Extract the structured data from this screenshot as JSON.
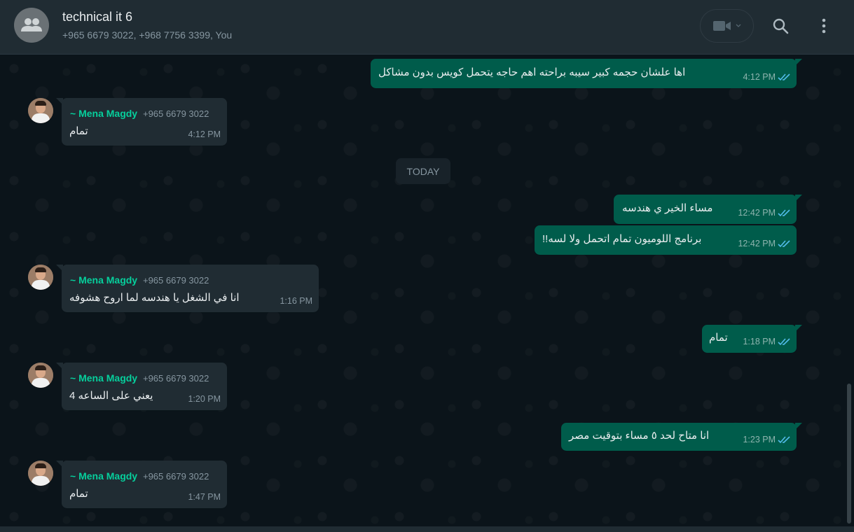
{
  "header": {
    "title": "technical it 6",
    "participants": "+965 6679 3022, +968 7756 3399, You"
  },
  "date_divider": "TODAY",
  "messages": [
    {
      "direction": "out",
      "text": "اها علشان حجمه كبير سيبه براحته اهم حاجه يتحمل كويس بدون مشاكل",
      "time": "4:12 PM"
    },
    {
      "direction": "in",
      "sender": "~ Mena Magdy",
      "phone": "+965 6679 3022",
      "text": "تمام",
      "time": "4:12 PM"
    },
    {
      "direction": "out",
      "text": "مساء الخير ي هندسه",
      "time": "12:42 PM"
    },
    {
      "direction": "out",
      "text": "برنامج اللوميون تمام اتحمل ولا لسه!!",
      "time": "12:42 PM"
    },
    {
      "direction": "in",
      "sender": "~ Mena Magdy",
      "phone": "+965 6679 3022",
      "text": "انا في الشغل يا هندسه لما اروح هشوفه",
      "time": "1:16 PM"
    },
    {
      "direction": "out",
      "text": "تمام",
      "time": "1:18 PM"
    },
    {
      "direction": "in",
      "sender": "~ Mena Magdy",
      "phone": "+965 6679 3022",
      "text": "يعني على الساعه 4",
      "time": "1:20 PM"
    },
    {
      "direction": "out",
      "text": "انا متاح لحد ٥ مساء بتوقيت مصر",
      "time": "1:23 PM"
    },
    {
      "direction": "in",
      "sender": "~ Mena Magdy",
      "phone": "+965 6679 3022",
      "text": "تمام",
      "time": "1:47 PM"
    }
  ],
  "colors": {
    "outgoing_bubble": "#005c4b",
    "incoming_bubble": "#202c33",
    "sender_name": "#06cf9c",
    "read_ticks": "#53bdeb"
  },
  "icons": {
    "video_call": "video-camera-icon",
    "search": "search-icon",
    "menu": "kebab-menu-icon",
    "read_receipt": "double-check-icon"
  }
}
